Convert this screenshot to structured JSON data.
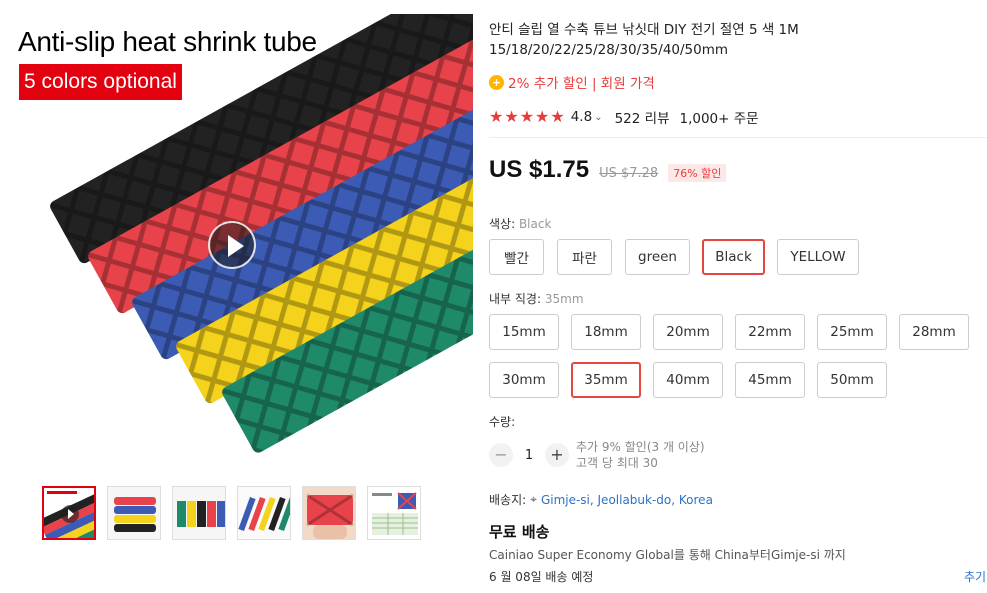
{
  "gallery": {
    "promo_title": "Anti-slip heat shrink tube",
    "promo_badge": "5 colors optional",
    "thumbnail_count": 6
  },
  "product": {
    "title": "안티 슬립 열 수축 튜브 낚싯대 DIY 전기 절연 5 색 1M 15/18/20/22/25/28/30/35/40/50mm",
    "promo_text": "2% 추가 할인 | 회원 가격",
    "rating": "4.8",
    "reviews": "522 리뷰",
    "orders": "1,000+ 주문",
    "price": "US $1.75",
    "original_price": "US $7.28",
    "discount": "76% 할인",
    "accent_color": "#e83b3b"
  },
  "color_option": {
    "label": "색상:",
    "selected": "Black",
    "options": [
      "빨간",
      "파란",
      "green",
      "Black",
      "YELLOW"
    ]
  },
  "size_option": {
    "label": "내부 직경:",
    "selected": "35mm",
    "options": [
      "15mm",
      "18mm",
      "20mm",
      "22mm",
      "25mm",
      "28mm",
      "30mm",
      "35mm",
      "40mm",
      "45mm",
      "50mm"
    ]
  },
  "quantity": {
    "label": "수량:",
    "value": "1",
    "minus": "−",
    "plus": "+",
    "note_discount": "추가 9% 할인(3 개 이상)",
    "note_limit": "고객 당 최대 30"
  },
  "shipping": {
    "ship_to_label": "배송지:",
    "location": "Gimje-si, Jeollabuk-do, Korea",
    "free_shipping": "무료 배송",
    "description": "Cainiao Super Economy Global를 통해 China부터Gimje-si 까지",
    "delivery_date": "6 월 08일 배송 예정",
    "more_link": "추기"
  }
}
